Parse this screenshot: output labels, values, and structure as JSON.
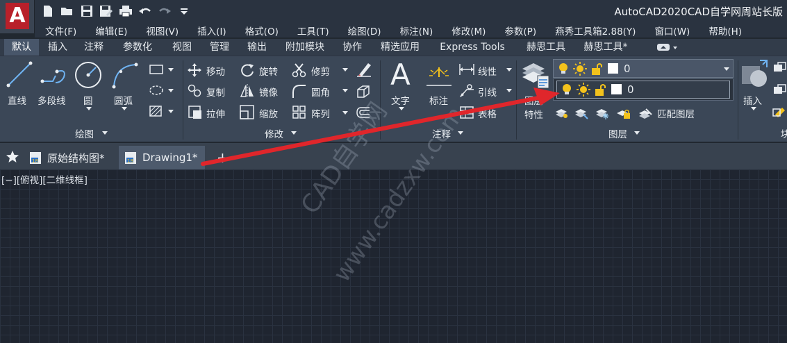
{
  "app": {
    "logo_letter": "A",
    "title": "AutoCAD2020CAD自学网周站长版"
  },
  "quick_access": {
    "icons": [
      "new-icon",
      "open-icon",
      "save-icon",
      "save-as-icon",
      "print-icon",
      "undo-icon",
      "redo-icon",
      "customize-icon"
    ]
  },
  "menubar": {
    "items": [
      "文件(F)",
      "编辑(E)",
      "视图(V)",
      "插入(I)",
      "格式(O)",
      "工具(T)",
      "绘图(D)",
      "标注(N)",
      "修改(M)",
      "参数(P)",
      "燕秀工具箱2.88(Y)",
      "窗口(W)",
      "帮助(H)"
    ]
  },
  "ribbon_tabs": {
    "items": [
      "默认",
      "插入",
      "注释",
      "参数化",
      "视图",
      "管理",
      "输出",
      "附加模块",
      "协作",
      "精选应用",
      "Express Tools",
      "赫思工具",
      "赫思工具*"
    ],
    "active": "默认"
  },
  "draw_panel": {
    "title": "绘图",
    "line": "直线",
    "polyline": "多段线",
    "circle": "圆",
    "arc": "圆弧"
  },
  "modify_panel": {
    "title": "修改",
    "move": "移动",
    "rotate": "旋转",
    "trim": "修剪",
    "copy": "复制",
    "mirror": "镜像",
    "fillet": "圆角",
    "stretch": "拉伸",
    "scale": "缩放",
    "array": "阵列"
  },
  "annotation_panel": {
    "title": "注释",
    "text": "文字",
    "dimension": "标注",
    "linear": "线性",
    "leader": "引线",
    "table": "表格"
  },
  "layers_panel": {
    "title": "图层",
    "layer_properties": "图层",
    "properties_label": "特性",
    "match_layer": "匹配图层",
    "current_layer": "0",
    "dropdown_layer": "0"
  },
  "insert_panel": {
    "insert": "插入",
    "block_partial": "块"
  },
  "doc_tabs": {
    "items": [
      "原始结构图*",
      "Drawing1*"
    ],
    "active": "Drawing1*",
    "add": "+"
  },
  "viewport": {
    "label": "[−][俯视][二维线框]"
  },
  "watermark": {
    "line1": "CAD自学网",
    "line2": "www.cadzxw.com"
  },
  "colors": {
    "arrow": "#e0262b",
    "bulb": "#f3c21c",
    "logo": "#b8202a"
  }
}
